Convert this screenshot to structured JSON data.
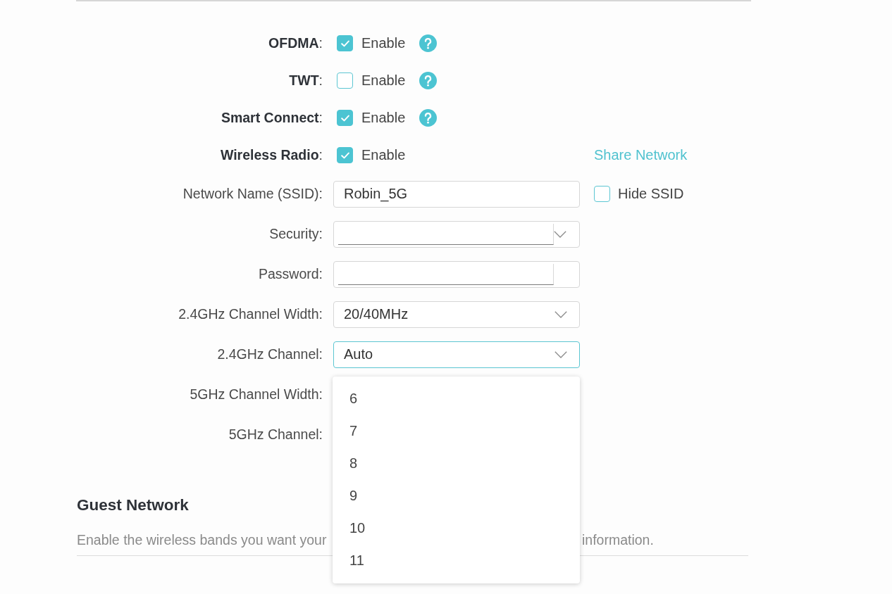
{
  "settings": [
    {
      "label": "**OFDMA**:",
      "kind": "checkbox",
      "option": "Enable",
      "checked": true,
      "help": true
    },
    {
      "label": "**TWT**:",
      "kind": "checkbox",
      "option": "Enable",
      "checked": false,
      "help": true
    },
    {
      "label": "**Smart Connect**:",
      "kind": "checkbox",
      "option": "Enable",
      "checked": true,
      "help": true
    },
    {
      "label": "**Wireless Radio**:",
      "kind": "checkbox",
      "option": "Enable",
      "checked": true,
      "link": "Share Network"
    },
    {
      "label": "Network Name (SSID):",
      "kind": "text",
      "value": "Robin_5G",
      "extra": {
        "option": "Hide SSID",
        "checked": false
      }
    },
    {
      "label": "Security:",
      "kind": "select",
      "focused": false
    },
    {
      "label": "Password:",
      "kind": "password"
    },
    {
      "label": "2.4GHz Channel Width:",
      "kind": "select",
      "value": "20/40MHz",
      "focused": false
    },
    {
      "label": "2.4GHz Channel:",
      "kind": "select",
      "value": "Auto",
      "focused": true,
      "expanded": true,
      "options": [
        "6",
        "7",
        "8",
        "9",
        "10",
        "11"
      ]
    },
    {
      "label": "5GHz Channel Width:",
      "kind": "covered"
    },
    {
      "label": "5GHz Channel:",
      "kind": "covered"
    }
  ],
  "guest_network": {
    "title": "Guest Network",
    "description_parts": [
      "Enable the wireless bands you want your",
      "information."
    ]
  }
}
